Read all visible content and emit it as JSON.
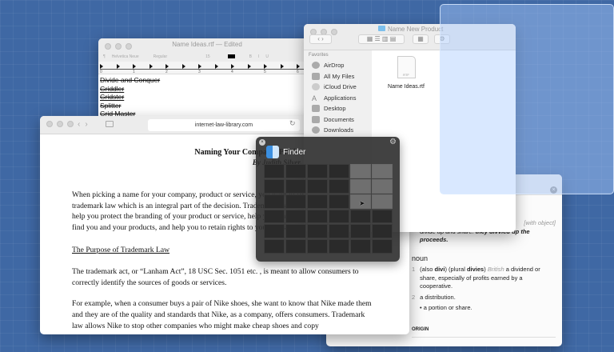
{
  "textedit": {
    "title": "Name Ideas.rtf",
    "status": "— Edited",
    "toolbar": {
      "para": "¶",
      "font": "Helvetica Neue",
      "style": "Regular",
      "size": "15",
      "bold": "B",
      "italic": "I",
      "underline": "U"
    },
    "ruler": [
      "0",
      "1",
      "2",
      "3",
      "4",
      "5",
      "6"
    ],
    "lines": [
      "Divide and Conquer",
      "Griddler",
      "Gridster",
      "Splitter",
      "Grid Master"
    ]
  },
  "finder": {
    "title": "Name New Product",
    "sidebar_header": "Favorites",
    "sidebar": [
      "AirDrop",
      "All My Files",
      "iCloud Drive",
      "Applications",
      "Desktop",
      "Documents",
      "Downloads"
    ],
    "file": {
      "name": "Name Ideas.rtf",
      "ext": "RTF"
    }
  },
  "safari": {
    "url": "internet-law-library.com",
    "title": "Naming Your Company, Product or Service",
    "author": "By Judith Silver, Esq.",
    "paragraphs": [
      "When picking a name for your company, product or service, you want to first understand trademark law which is an integral part of the decision.  Trademark law is important because it can help you protect the branding of your product or service, help you make sure your customer can find you and your products, and help you to retain rights to your domain names."
    ],
    "heading": "The Purpose of Trademark Law",
    "paragraphs2": [
      "The trademark act, or “Lanham Act”, 18 USC Sec. 1051 etc. , is meant to allow consumers to correctly identify the sources of goods or services.",
      "For example, when a consumer buys a pair of Nike shoes, she want to know that Nike made them and they are of the quality and standards that Nike, as a company, offers consumers. Trademark law allows Nike to stop other companies who might make cheap shoes and copy"
    ]
  },
  "dictionary": {
    "with_object": "[with object]",
    "def_a": "divide up and share: ",
    "example": "they divvied up the proceeds.",
    "pos": "noun",
    "sense1": {
      "num": "1",
      "text_a": "(also ",
      "divi": "divi",
      "text_b": ") (plural ",
      "divies": "divies",
      "text_c": ") ",
      "region": "British",
      "text_d": " a dividend or share, especially of profits earned by a cooperative."
    },
    "sense2": {
      "num": "2",
      "text": "a distribution.",
      "sub": "• a portion or share."
    },
    "origin": "ORIGIN"
  },
  "hud": {
    "app": "Finder",
    "grid": {
      "cols": 6,
      "rows": 6,
      "selected": {
        "col_from": 5,
        "col_to": 6,
        "row_from": 1,
        "row_to": 3
      }
    }
  }
}
